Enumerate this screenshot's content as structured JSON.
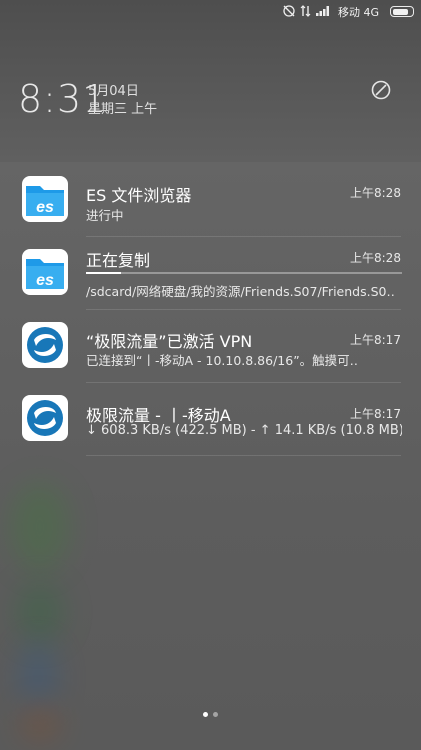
{
  "status_bar": {
    "carrier": "移动 4G",
    "battery_level": 0.84
  },
  "header": {
    "time": "8:31",
    "date": "5月04日",
    "weekday": "星期三 上午"
  },
  "notifications": [
    {
      "app_icon": "es-file-explorer-icon",
      "title": "ES 文件浏览器",
      "text": "进行中",
      "time": "上午8:28"
    },
    {
      "app_icon": "es-file-explorer-icon",
      "title": "正在复制",
      "text": "/sdcard/网络硬盘/我的资源/Friends.S07/Friends.S0‥",
      "time": "上午8:28",
      "progress": 0.11
    },
    {
      "app_icon": "vpn-app-icon",
      "title": "“极限流量”已激活 VPN",
      "text": "已连接到“丨-移动A - 10.10.8.86/16”。触摸可‥",
      "time": "上午8:17"
    },
    {
      "app_icon": "vpn-app-icon",
      "title": "极限流量 - 丨-移动A",
      "text": "↓ 608.3 KB/s (422.5 MB) - ↑ 14.1 KB/s (10.8 MB)",
      "time": "上午8:17"
    }
  ],
  "pager": {
    "pages": 2,
    "current": 1
  },
  "colors": {
    "es_blue": "#1e9ae8",
    "vpn_blue": "#1877b8"
  }
}
